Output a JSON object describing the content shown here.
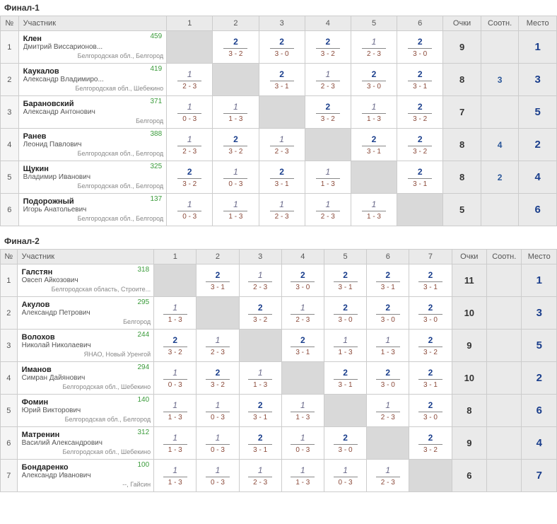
{
  "headers": {
    "num": "№",
    "participant": "Участник",
    "points": "Очки",
    "ratio": "Соотн.",
    "place": "Место"
  },
  "groups": [
    {
      "title": "Финал-1",
      "rounds": 6,
      "rows": [
        {
          "num": "1",
          "surname": "Клен",
          "fullname": "Дмитрий Виссарионов...",
          "region": "Белгородская обл., Белгород",
          "rating": "459",
          "cells": [
            null,
            {
              "pts": "2",
              "score": "3 - 2"
            },
            {
              "pts": "2",
              "score": "3 - 0"
            },
            {
              "pts": "2",
              "score": "3 - 2"
            },
            {
              "pts": "1",
              "score": "2 - 3",
              "italic": true
            },
            {
              "pts": "2",
              "score": "3 - 0"
            }
          ],
          "points": "9",
          "ratio": "",
          "place": "1"
        },
        {
          "num": "2",
          "surname": "Каукалов",
          "fullname": "Александр Владимиро...",
          "region": "Белгородская обл., Шебекино",
          "rating": "419",
          "cells": [
            {
              "pts": "1",
              "score": "2 - 3",
              "italic": true
            },
            null,
            {
              "pts": "2",
              "score": "3 - 1"
            },
            {
              "pts": "1",
              "score": "2 - 3",
              "italic": true
            },
            {
              "pts": "2",
              "score": "3 - 0"
            },
            {
              "pts": "2",
              "score": "3 - 1"
            }
          ],
          "points": "8",
          "ratio": "3",
          "place": "3"
        },
        {
          "num": "3",
          "surname": "Барановский",
          "fullname": "Александр Антонович",
          "region": "Белгород",
          "rating": "371",
          "cells": [
            {
              "pts": "1",
              "score": "0 - 3",
              "italic": true
            },
            {
              "pts": "1",
              "score": "1 - 3",
              "italic": true
            },
            null,
            {
              "pts": "2",
              "score": "3 - 2"
            },
            {
              "pts": "1",
              "score": "1 - 3",
              "italic": true
            },
            {
              "pts": "2",
              "score": "3 - 2"
            }
          ],
          "points": "7",
          "ratio": "",
          "place": "5"
        },
        {
          "num": "4",
          "surname": "Ранев",
          "fullname": "Леонид Павлович",
          "region": "Белгородская обл., Белгород",
          "rating": "388",
          "cells": [
            {
              "pts": "1",
              "score": "2 - 3",
              "italic": true
            },
            {
              "pts": "2",
              "score": "3 - 2"
            },
            {
              "pts": "1",
              "score": "2 - 3",
              "italic": true
            },
            null,
            {
              "pts": "2",
              "score": "3 - 1"
            },
            {
              "pts": "2",
              "score": "3 - 2"
            }
          ],
          "points": "8",
          "ratio": "4",
          "place": "2"
        },
        {
          "num": "5",
          "surname": "Щукин",
          "fullname": "Владимир Иванович",
          "region": "Белгородская обл., Белгород",
          "rating": "325",
          "cells": [
            {
              "pts": "2",
              "score": "3 - 2"
            },
            {
              "pts": "1",
              "score": "0 - 3",
              "italic": true
            },
            {
              "pts": "2",
              "score": "3 - 1"
            },
            {
              "pts": "1",
              "score": "1 - 3",
              "italic": true
            },
            null,
            {
              "pts": "2",
              "score": "3 - 1"
            }
          ],
          "points": "8",
          "ratio": "2",
          "place": "4"
        },
        {
          "num": "6",
          "surname": "Подорожный",
          "fullname": "Игорь Анатольевич",
          "region": "Белгородская обл., Белгород",
          "rating": "137",
          "cells": [
            {
              "pts": "1",
              "score": "0 - 3",
              "italic": true
            },
            {
              "pts": "1",
              "score": "1 - 3",
              "italic": true
            },
            {
              "pts": "1",
              "score": "2 - 3",
              "italic": true
            },
            {
              "pts": "1",
              "score": "2 - 3",
              "italic": true
            },
            {
              "pts": "1",
              "score": "1 - 3",
              "italic": true
            },
            null
          ],
          "points": "5",
          "ratio": "",
          "place": "6"
        }
      ]
    },
    {
      "title": "Финал-2",
      "rounds": 7,
      "rows": [
        {
          "num": "1",
          "surname": "Галстян",
          "fullname": "Овсеп Айкозович",
          "region": "Белгородская область, Строите...",
          "rating": "318",
          "cells": [
            null,
            {
              "pts": "2",
              "score": "3 - 1"
            },
            {
              "pts": "1",
              "score": "2 - 3",
              "italic": true
            },
            {
              "pts": "2",
              "score": "3 - 0"
            },
            {
              "pts": "2",
              "score": "3 - 1"
            },
            {
              "pts": "2",
              "score": "3 - 1"
            },
            {
              "pts": "2",
              "score": "3 - 1"
            }
          ],
          "points": "11",
          "ratio": "",
          "place": "1"
        },
        {
          "num": "2",
          "surname": "Акулов",
          "fullname": "Александр Петрович",
          "region": "Белгород",
          "rating": "295",
          "cells": [
            {
              "pts": "1",
              "score": "1 - 3",
              "italic": true
            },
            null,
            {
              "pts": "2",
              "score": "3 - 2"
            },
            {
              "pts": "1",
              "score": "2 - 3",
              "italic": true
            },
            {
              "pts": "2",
              "score": "3 - 0"
            },
            {
              "pts": "2",
              "score": "3 - 0"
            },
            {
              "pts": "2",
              "score": "3 - 0"
            }
          ],
          "points": "10",
          "ratio": "",
          "place": "3"
        },
        {
          "num": "3",
          "surname": "Волохов",
          "fullname": "Николай Николаевич",
          "region": "ЯНАО, Новый Уренгой",
          "rating": "244",
          "cells": [
            {
              "pts": "2",
              "score": "3 - 2"
            },
            {
              "pts": "1",
              "score": "2 - 3",
              "italic": true
            },
            null,
            {
              "pts": "2",
              "score": "3 - 1"
            },
            {
              "pts": "1",
              "score": "1 - 3",
              "italic": true
            },
            {
              "pts": "1",
              "score": "1 - 3",
              "italic": true
            },
            {
              "pts": "2",
              "score": "3 - 2"
            }
          ],
          "points": "9",
          "ratio": "",
          "place": "5"
        },
        {
          "num": "4",
          "surname": "Иманов",
          "fullname": "Симран Дайянович",
          "region": "Белгородская обл., Шебекино",
          "rating": "294",
          "cells": [
            {
              "pts": "1",
              "score": "0 - 3",
              "italic": true
            },
            {
              "pts": "2",
              "score": "3 - 2"
            },
            {
              "pts": "1",
              "score": "1 - 3",
              "italic": true
            },
            null,
            {
              "pts": "2",
              "score": "3 - 1"
            },
            {
              "pts": "2",
              "score": "3 - 0"
            },
            {
              "pts": "2",
              "score": "3 - 1"
            }
          ],
          "points": "10",
          "ratio": "",
          "place": "2"
        },
        {
          "num": "5",
          "surname": "Фомин",
          "fullname": "Юрий Викторович",
          "region": "Белгородская обл., Белгород",
          "rating": "140",
          "cells": [
            {
              "pts": "1",
              "score": "1 - 3",
              "italic": true
            },
            {
              "pts": "1",
              "score": "0 - 3",
              "italic": true
            },
            {
              "pts": "2",
              "score": "3 - 1"
            },
            {
              "pts": "1",
              "score": "1 - 3",
              "italic": true
            },
            null,
            {
              "pts": "1",
              "score": "2 - 3",
              "italic": true
            },
            {
              "pts": "2",
              "score": "3 - 0"
            }
          ],
          "points": "8",
          "ratio": "",
          "place": "6"
        },
        {
          "num": "6",
          "surname": "Матренин",
          "fullname": "Василий Александрович",
          "region": "Белгородская обл., Шебекино",
          "rating": "312",
          "cells": [
            {
              "pts": "1",
              "score": "1 - 3",
              "italic": true
            },
            {
              "pts": "1",
              "score": "0 - 3",
              "italic": true
            },
            {
              "pts": "2",
              "score": "3 - 1"
            },
            {
              "pts": "1",
              "score": "0 - 3",
              "italic": true
            },
            {
              "pts": "2",
              "score": "3 - 0"
            },
            null,
            {
              "pts": "2",
              "score": "3 - 2"
            }
          ],
          "points": "9",
          "ratio": "",
          "place": "4"
        },
        {
          "num": "7",
          "surname": "Бондаренко",
          "fullname": "Александр Иванович",
          "region": "--, Гайсин",
          "rating": "100",
          "cells": [
            {
              "pts": "1",
              "score": "1 - 3",
              "italic": true
            },
            {
              "pts": "1",
              "score": "0 - 3",
              "italic": true
            },
            {
              "pts": "1",
              "score": "2 - 3",
              "italic": true
            },
            {
              "pts": "1",
              "score": "1 - 3",
              "italic": true
            },
            {
              "pts": "1",
              "score": "0 - 3",
              "italic": true
            },
            {
              "pts": "1",
              "score": "2 - 3",
              "italic": true
            },
            null
          ],
          "points": "6",
          "ratio": "",
          "place": "7"
        }
      ]
    }
  ]
}
